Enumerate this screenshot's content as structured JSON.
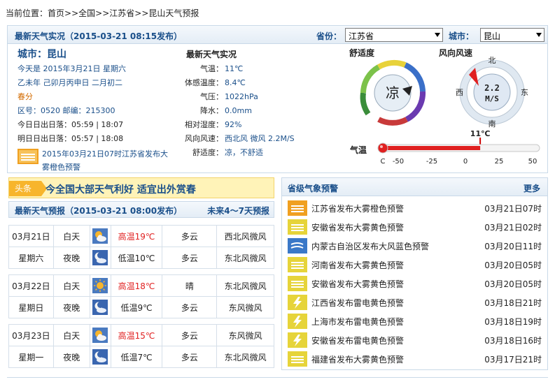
{
  "breadcrumb": {
    "prefix": "当前位置：",
    "items": [
      "首页",
      ">>",
      "全国",
      ">>",
      "江苏省",
      ">>",
      "昆山天气预报"
    ]
  },
  "current": {
    "title": "最新天气实况（2015-03-21  08:15发布）",
    "province_label": "省份：",
    "province_value": "江苏省",
    "city_label": "城市：",
    "city_value": "昆山",
    "city_title": "城市：昆山",
    "today": "今天是 2015年3月21日 星期六",
    "lunar": "乙未年 己卯月丙申日 二月初二",
    "solar_term": "春分",
    "codes": "区号：0520   邮编：215300",
    "sun_today": "今日日出日落：05:59 | 18:07",
    "sun_tomorrow": "明日日出日落：05:57 | 18:08",
    "alert_text": "2015年03月21日07时江苏省发布大雾橙色预警",
    "obs_title": "最新天气实况",
    "obs": [
      {
        "k": "气温：",
        "v": "11℃"
      },
      {
        "k": "体感温度：",
        "v": "8.4℃"
      },
      {
        "k": "气压：",
        "v": "1022hPa"
      },
      {
        "k": "降水：",
        "v": "0.0mm"
      },
      {
        "k": "相对湿度：",
        "v": "92%"
      },
      {
        "k": "风向风速：",
        "v": "西北风 微风 2.2M/S"
      },
      {
        "k": "舒适度：",
        "v": "凉，不舒适"
      }
    ]
  },
  "comfort": {
    "title": "舒适度",
    "value": "凉"
  },
  "wind": {
    "title": "风向风速",
    "speed": "2.2",
    "unit": "M/S",
    "north": "北",
    "south": "南",
    "east": "东",
    "west": "西"
  },
  "thermometer": {
    "title": "气温",
    "current": "11℃",
    "current_value": 11,
    "unit": "C",
    "ticks": [
      "-50",
      "-25",
      "0",
      "25",
      "50"
    ],
    "min": -50,
    "max": 50
  },
  "headline": {
    "tag": "头条",
    "text": "今全国大部天气利好  适宜出外赏春"
  },
  "forecast": {
    "title": "最新天气预报（2015-03-21  08:00发布）",
    "more": "未来4～7天预报",
    "days": [
      {
        "date": "03月21日",
        "weekday": "星期六",
        "day": {
          "label": "白天",
          "icon": "partly-cloudy-icon",
          "temp": "高温19℃",
          "weather": "多云",
          "wind": "西北风微风"
        },
        "night": {
          "label": "夜晚",
          "icon": "moon-cloud-icon",
          "temp": "低温10℃",
          "weather": "多云",
          "wind": "东北风微风"
        }
      },
      {
        "date": "03月22日",
        "weekday": "星期日",
        "day": {
          "label": "白天",
          "icon": "sun-icon",
          "temp": "高温18℃",
          "weather": "晴",
          "wind": "东北风微风"
        },
        "night": {
          "label": "夜晚",
          "icon": "moon-cloud-icon",
          "temp": "低温9℃",
          "weather": "多云",
          "wind": "东风微风"
        }
      },
      {
        "date": "03月23日",
        "weekday": "星期一",
        "day": {
          "label": "白天",
          "icon": "partly-cloudy-icon",
          "temp": "高温15℃",
          "weather": "多云",
          "wind": "东风微风"
        },
        "night": {
          "label": "夜晚",
          "icon": "moon-cloud-icon",
          "temp": "低温7℃",
          "weather": "多云",
          "wind": "东北风微风"
        }
      }
    ]
  },
  "warnings": {
    "title": "省级气象预警",
    "more": "更多",
    "items": [
      {
        "name": "江苏省发布大雾橙色预警",
        "time": "03月21日07时",
        "color": "#f0a020",
        "type": "fog"
      },
      {
        "name": "安徽省发布大雾黄色预警",
        "time": "03月21日02时",
        "color": "#e6d43a",
        "type": "fog"
      },
      {
        "name": "内蒙古自治区发布大风蓝色预警",
        "time": "03月20日11时",
        "color": "#3a78c8",
        "type": "wind"
      },
      {
        "name": "河南省发布大雾黄色预警",
        "time": "03月20日05时",
        "color": "#e6d43a",
        "type": "fog"
      },
      {
        "name": "安徽省发布大雾黄色预警",
        "time": "03月20日05时",
        "color": "#e6d43a",
        "type": "fog"
      },
      {
        "name": "江西省发布雷电黄色预警",
        "time": "03月18日21时",
        "color": "#e6d43a",
        "type": "lightning"
      },
      {
        "name": "上海市发布雷电黄色预警",
        "time": "03月18日19时",
        "color": "#e6d43a",
        "type": "lightning"
      },
      {
        "name": "安徽省发布雷电黄色预警",
        "time": "03月18日16时",
        "color": "#e6d43a",
        "type": "lightning"
      },
      {
        "name": "福建省发布大雾黄色预警",
        "time": "03月17日21时",
        "color": "#e6d43a",
        "type": "fog"
      }
    ]
  }
}
